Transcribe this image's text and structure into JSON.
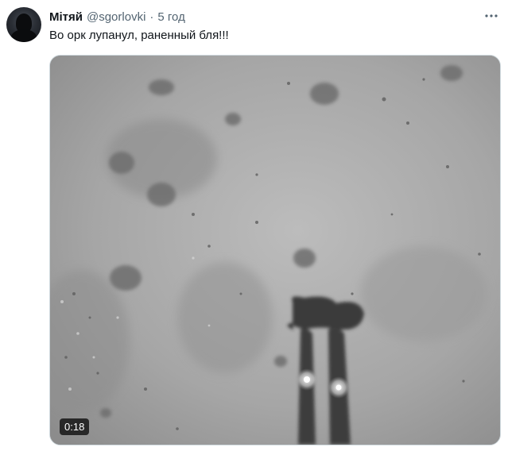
{
  "tweet": {
    "display_name": "Мітяй",
    "handle": "@sgorlovki",
    "separator": "·",
    "time": "5 год",
    "text": "Во орк лупанул, раненный бля!!!",
    "more_icon": "more-horizontal-icon"
  },
  "media": {
    "type": "video",
    "duration": "0:18",
    "description_palette": {
      "snow": "#b7b7b7",
      "shadow": "#3c3c3c",
      "hotspot": "#ffffff"
    }
  },
  "colors": {
    "text_primary": "#0f1419",
    "text_secondary": "#536471",
    "border": "#cfd9de"
  }
}
